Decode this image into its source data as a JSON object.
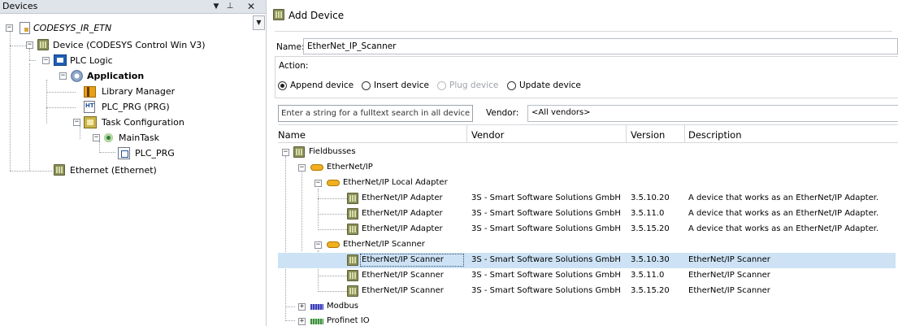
{
  "devices_panel": {
    "title": "Devices",
    "tree": [
      {
        "id": "project",
        "label": "CODESYS_IR_ETN",
        "icon": "project-icon"
      },
      {
        "id": "device",
        "label": "Device (CODESYS Control Win V3)",
        "icon": "device-icon"
      },
      {
        "id": "plc_logic",
        "label": "PLC Logic",
        "icon": "plc-logic-icon"
      },
      {
        "id": "application",
        "label": "Application",
        "icon": "application-gear-icon"
      },
      {
        "id": "library_manager",
        "label": "Library Manager",
        "icon": "library-manager-icon"
      },
      {
        "id": "plc_prg",
        "label": "PLC_PRG (PRG)",
        "icon": "program-icon"
      },
      {
        "id": "task_configuration",
        "label": "Task Configuration",
        "icon": "task-configuration-icon"
      },
      {
        "id": "main_task",
        "label": "MainTask",
        "icon": "task-icon"
      },
      {
        "id": "plc_prg_call",
        "label": "PLC_PRG",
        "icon": "pou-call-icon"
      },
      {
        "id": "ethernet",
        "label": "Ethernet (Ethernet)",
        "icon": "device-icon"
      }
    ]
  },
  "add_device": {
    "title": "Add Device",
    "name_label": "Name:",
    "name_value": "EtherNet_IP_Scanner",
    "action_label": "Action:",
    "actions": [
      {
        "label": "Append device",
        "selected": true,
        "enabled": true
      },
      {
        "label": "Insert device",
        "selected": false,
        "enabled": true
      },
      {
        "label": "Plug device",
        "selected": false,
        "enabled": false
      },
      {
        "label": "Update device",
        "selected": false,
        "enabled": true
      }
    ],
    "search_placeholder": "Enter a string for a fulltext search in all devices...",
    "vendor_label": "Vendor:",
    "vendor_value": "<All vendors>",
    "columns": [
      "Name",
      "Vendor",
      "Version",
      "Description"
    ],
    "rows": [
      {
        "name": "Fieldbusses",
        "vendor": "",
        "version": "",
        "description": ""
      },
      {
        "name": "EtherNet/IP",
        "vendor": "",
        "version": "",
        "description": ""
      },
      {
        "name": "EtherNet/IP Local Adapter",
        "vendor": "",
        "version": "",
        "description": ""
      },
      {
        "name": "EtherNet/IP Adapter",
        "vendor": "3S - Smart Software Solutions GmbH",
        "version": "3.5.10.20",
        "description": "A device that works as an EtherNet/IP Adapter."
      },
      {
        "name": "EtherNet/IP Adapter",
        "vendor": "3S - Smart Software Solutions GmbH",
        "version": "3.5.11.0",
        "description": "A device that works as an EtherNet/IP Adapter."
      },
      {
        "name": "EtherNet/IP Adapter",
        "vendor": "3S - Smart Software Solutions GmbH",
        "version": "3.5.15.20",
        "description": "A device that works as an EtherNet/IP Adapter."
      },
      {
        "name": "EtherNet/IP Scanner",
        "vendor": "",
        "version": "",
        "description": ""
      },
      {
        "name": "EtherNet/IP Scanner",
        "vendor": "3S - Smart Software Solutions GmbH",
        "version": "3.5.10.30",
        "description": "EtherNet/IP Scanner",
        "selected": true
      },
      {
        "name": "EtherNet/IP Scanner",
        "vendor": "3S - Smart Software Solutions GmbH",
        "version": "3.5.11.0",
        "description": "EtherNet/IP Scanner"
      },
      {
        "name": "EtherNet/IP Scanner",
        "vendor": "3S - Smart Software Solutions GmbH",
        "version": "3.5.15.20",
        "description": "EtherNet/IP Scanner"
      },
      {
        "name": "Modbus",
        "vendor": "",
        "version": "",
        "description": ""
      },
      {
        "name": "Profinet IO",
        "vendor": "",
        "version": "",
        "description": ""
      }
    ]
  },
  "colors": {
    "selection": "#cde3f5",
    "panel_header": "#dfe3ea"
  }
}
